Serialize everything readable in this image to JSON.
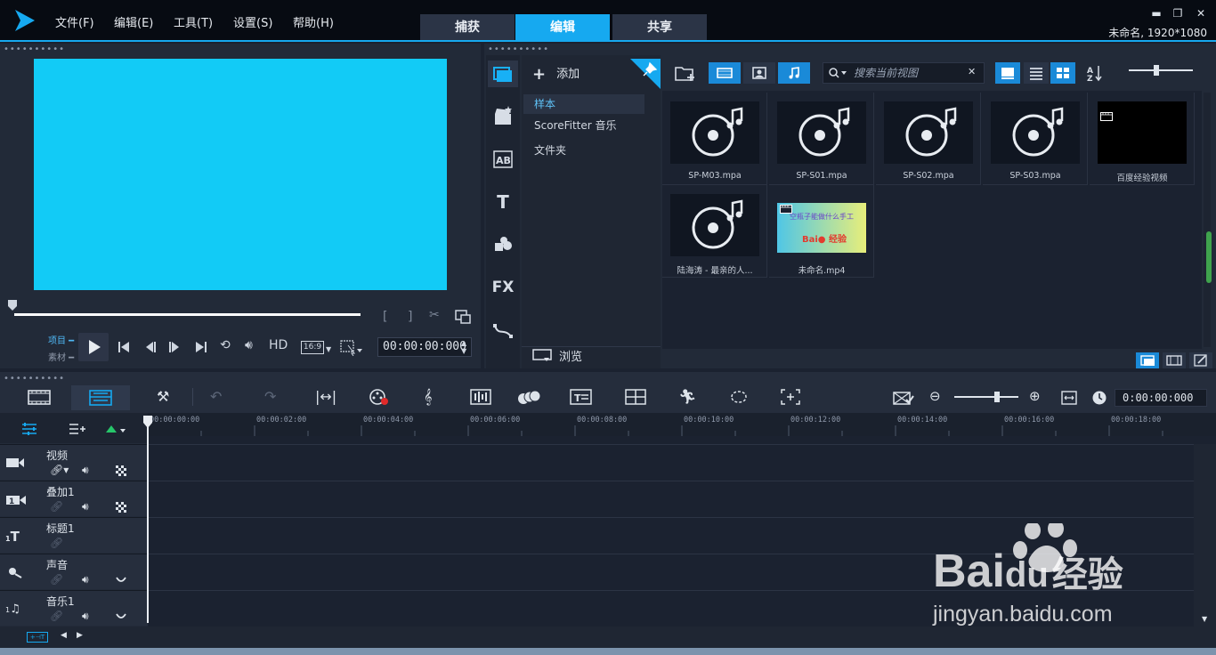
{
  "menu": [
    "文件(F)",
    "编辑(E)",
    "工具(T)",
    "设置(S)",
    "帮助(H)"
  ],
  "mode_tabs": [
    {
      "label": "捕获",
      "active": false
    },
    {
      "label": "编辑",
      "active": true
    },
    {
      "label": "共享",
      "active": false
    }
  ],
  "window_controls": {
    "minimize": "▬",
    "restore": "❐",
    "close": "✕"
  },
  "project_info": "未命名, 1920*1080",
  "player": {
    "preview_color": "#12cbf6",
    "mode_labels": {
      "project": "项目",
      "clip": "素材"
    },
    "controls": {
      "hd": "HD",
      "aspect": "16:9"
    },
    "timecode": "00:00:00:000"
  },
  "library": {
    "add_label": "添加",
    "folders": [
      {
        "label": "样本",
        "selected": true
      },
      {
        "label": "ScoreFitter 音乐",
        "selected": false
      },
      {
        "label": "文件夹",
        "selected": false
      }
    ],
    "browse_label": "浏览",
    "search_placeholder": "搜索当前视图",
    "side_labels": {
      "fx": "FX"
    },
    "media": [
      {
        "label": "SP-M03.mpa",
        "type": "audio"
      },
      {
        "label": "SP-S01.mpa",
        "type": "audio"
      },
      {
        "label": "SP-S02.mpa",
        "type": "audio"
      },
      {
        "label": "SP-S03.mpa",
        "type": "audio"
      },
      {
        "label": "百度经验视频",
        "type": "video-black"
      },
      {
        "label": "陆海涛 - 最亲的人...",
        "type": "audio"
      },
      {
        "label": "未命名.mp4",
        "type": "video-thumb"
      }
    ],
    "thumb_caption": "空瓶子能做什么手工"
  },
  "timeline": {
    "timecode": "0:00:00:000",
    "ruler": [
      "00:00:00:00",
      "00:00:02:00",
      "00:00:04:00",
      "00:00:06:00",
      "00:00:08:00",
      "00:00:10:00",
      "00:00:12:00",
      "00:00:14:00",
      "00:00:16:00",
      "00:00:18:00"
    ],
    "tracks": [
      {
        "name": "视频",
        "icon": "video-track-icon"
      },
      {
        "name": "叠加1",
        "icon": "overlay-track-icon"
      },
      {
        "name": "标题1",
        "icon": "title-track-icon"
      },
      {
        "name": "声音",
        "icon": "voice-track-icon"
      },
      {
        "name": "音乐1",
        "icon": "music-track-icon"
      }
    ]
  },
  "watermark": {
    "brand": "Bai",
    "brand2": "du",
    "cn": "经验",
    "url": "jingyan.baidu.com"
  },
  "colors": {
    "accent": "#16a9f0",
    "panel": "#222a38",
    "background": "#1b2230"
  }
}
